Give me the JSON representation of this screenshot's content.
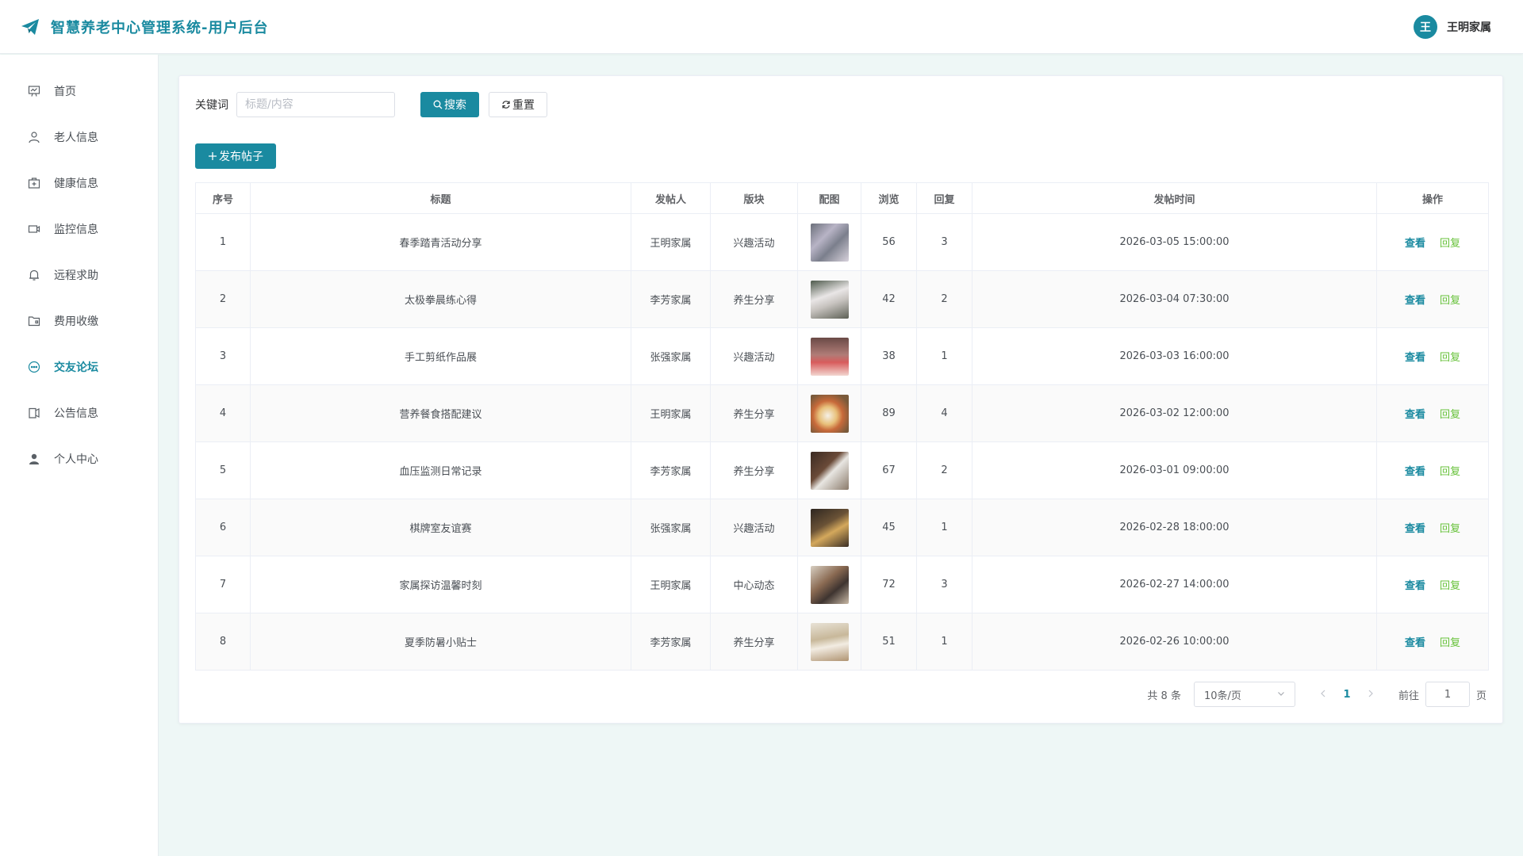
{
  "header": {
    "title": "智慧养老中心管理系统-用户后台",
    "user_avatar": "王",
    "user_name": "王明家属",
    "logo_icon": "paper-plane-icon"
  },
  "sidebar": {
    "items": [
      {
        "label": "首页",
        "icon": "dashboard-icon"
      },
      {
        "label": "老人信息",
        "icon": "user-icon"
      },
      {
        "label": "健康信息",
        "icon": "first-aid-icon"
      },
      {
        "label": "监控信息",
        "icon": "camera-icon"
      },
      {
        "label": "远程求助",
        "icon": "bell-icon"
      },
      {
        "label": "费用收缴",
        "icon": "folder-icon"
      },
      {
        "label": "交友论坛",
        "icon": "chat-icon",
        "active": true
      },
      {
        "label": "公告信息",
        "icon": "notice-icon"
      },
      {
        "label": "个人中心",
        "icon": "person-icon"
      }
    ]
  },
  "search": {
    "label": "关键词",
    "placeholder": "标题/内容",
    "search_label": "搜索",
    "reset_label": "重置",
    "publish_label": "发布帖子"
  },
  "table": {
    "columns": [
      "序号",
      "标题",
      "发帖人",
      "版块",
      "配图",
      "浏览",
      "回复",
      "发帖时间",
      "操作"
    ],
    "view_label": "查看",
    "reply_label": "回复",
    "rows": [
      {
        "no": "1",
        "title": "春季踏青活动分享",
        "author": "王明家属",
        "section": "兴趣活动",
        "views": "56",
        "replies": "3",
        "time": "2026-03-05 15:00:00"
      },
      {
        "no": "2",
        "title": "太极拳晨练心得",
        "author": "李芳家属",
        "section": "养生分享",
        "views": "42",
        "replies": "2",
        "time": "2026-03-04 07:30:00"
      },
      {
        "no": "3",
        "title": "手工剪纸作品展",
        "author": "张强家属",
        "section": "兴趣活动",
        "views": "38",
        "replies": "1",
        "time": "2026-03-03 16:00:00"
      },
      {
        "no": "4",
        "title": "营养餐食搭配建议",
        "author": "王明家属",
        "section": "养生分享",
        "views": "89",
        "replies": "4",
        "time": "2026-03-02 12:00:00"
      },
      {
        "no": "5",
        "title": "血压监测日常记录",
        "author": "李芳家属",
        "section": "养生分享",
        "views": "67",
        "replies": "2",
        "time": "2026-03-01 09:00:00"
      },
      {
        "no": "6",
        "title": "棋牌室友谊赛",
        "author": "张强家属",
        "section": "兴趣活动",
        "views": "45",
        "replies": "1",
        "time": "2026-02-28 18:00:00"
      },
      {
        "no": "7",
        "title": "家属探访温馨时刻",
        "author": "王明家属",
        "section": "中心动态",
        "views": "72",
        "replies": "3",
        "time": "2026-02-27 14:00:00"
      },
      {
        "no": "8",
        "title": "夏季防暑小贴士",
        "author": "李芳家属",
        "section": "养生分享",
        "views": "51",
        "replies": "1",
        "time": "2026-02-26 10:00:00"
      }
    ]
  },
  "pagination": {
    "total_text": "共 8 条",
    "page_size": "10条/页",
    "current_page": "1",
    "goto_label": "前往",
    "goto_value": "1",
    "page_unit": "页"
  },
  "colors": {
    "accent": "#1a8aa0",
    "reply": "#67c23a",
    "background": "#eef7f6"
  }
}
